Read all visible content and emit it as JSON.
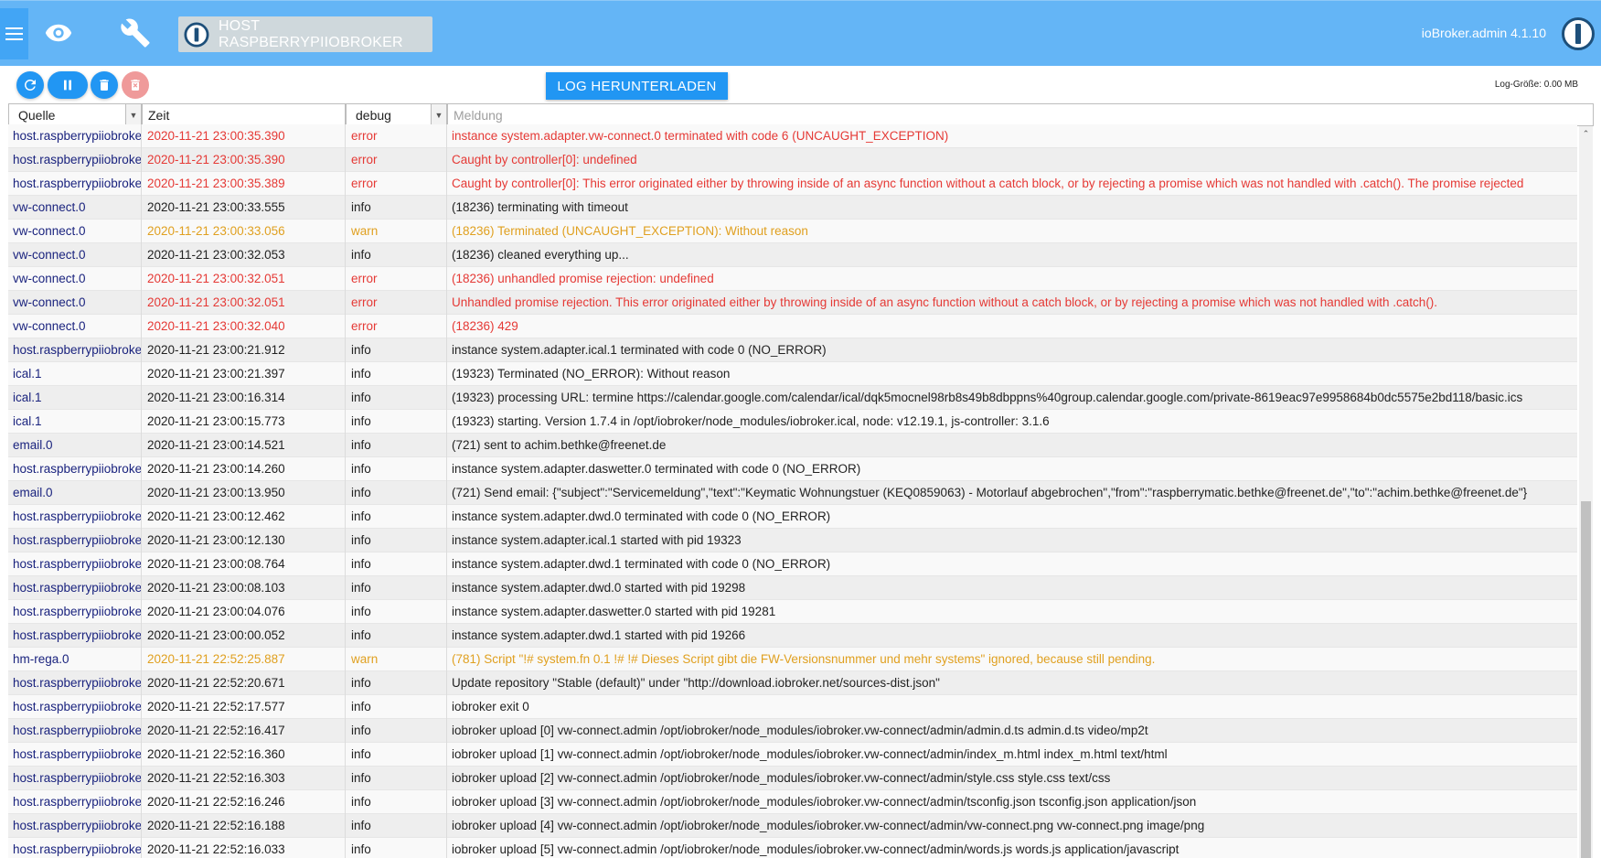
{
  "header": {
    "host_label": "HOST RASPBERRYPIIOBROKER",
    "version": "ioBroker.admin 4.1.10",
    "icons": [
      "menu-icon",
      "eye-icon",
      "wrench-icon",
      "iobroker-logo-icon"
    ]
  },
  "toolbar": {
    "buttons": [
      "refresh-icon",
      "pause-icon",
      "trash-icon",
      "delete-disabled-icon"
    ],
    "download_label": "LOG HERUNTERLADEN",
    "log_size": "Log-Größe: 0.00 MB"
  },
  "filters": {
    "source": "Quelle",
    "time": "Zeit",
    "severity": "debug",
    "message_placeholder": "Meldung"
  },
  "logs": [
    {
      "source": "host.raspberrypiiobroker",
      "time": "2020-11-21 23:00:35.390",
      "severity": "error",
      "message": "instance system.adapter.vw-connect.0 terminated with code 6 (UNCAUGHT_EXCEPTION)"
    },
    {
      "source": "host.raspberrypiiobroker",
      "time": "2020-11-21 23:00:35.390",
      "severity": "error",
      "message": "Caught by controller[0]: undefined"
    },
    {
      "source": "host.raspberrypiiobroker",
      "time": "2020-11-21 23:00:35.389",
      "severity": "error",
      "message": "Caught by controller[0]: This error originated either by throwing inside of an async function without a catch block, or by rejecting a promise which was not handled with .catch(). The promise rejected"
    },
    {
      "source": "vw-connect.0",
      "time": "2020-11-21 23:00:33.555",
      "severity": "info",
      "message": "(18236) terminating with timeout"
    },
    {
      "source": "vw-connect.0",
      "time": "2020-11-21 23:00:33.056",
      "severity": "warn",
      "message": "(18236) Terminated (UNCAUGHT_EXCEPTION): Without reason"
    },
    {
      "source": "vw-connect.0",
      "time": "2020-11-21 23:00:32.053",
      "severity": "info",
      "message": "(18236) cleaned everything up..."
    },
    {
      "source": "vw-connect.0",
      "time": "2020-11-21 23:00:32.051",
      "severity": "error",
      "message": "(18236) unhandled promise rejection: undefined"
    },
    {
      "source": "vw-connect.0",
      "time": "2020-11-21 23:00:32.051",
      "severity": "error",
      "message": "Unhandled promise rejection. This error originated either by throwing inside of an async function without a catch block, or by rejecting a promise which was not handled with .catch()."
    },
    {
      "source": "vw-connect.0",
      "time": "2020-11-21 23:00:32.040",
      "severity": "error",
      "message": "(18236) 429"
    },
    {
      "source": "host.raspberrypiiobroker",
      "time": "2020-11-21 23:00:21.912",
      "severity": "info",
      "message": "instance system.adapter.ical.1 terminated with code 0 (NO_ERROR)"
    },
    {
      "source": "ical.1",
      "time": "2020-11-21 23:00:21.397",
      "severity": "info",
      "message": "(19323) Terminated (NO_ERROR): Without reason"
    },
    {
      "source": "ical.1",
      "time": "2020-11-21 23:00:16.314",
      "severity": "info",
      "message": "(19323) processing URL: termine https://calendar.google.com/calendar/ical/dqk5mocnel98rb8s49b8dbppns%40group.calendar.google.com/private-8619eac97e9958684b0dc5575e2bd118/basic.ics"
    },
    {
      "source": "ical.1",
      "time": "2020-11-21 23:00:15.773",
      "severity": "info",
      "message": "(19323) starting. Version 1.7.4 in /opt/iobroker/node_modules/iobroker.ical, node: v12.19.1, js-controller: 3.1.6"
    },
    {
      "source": "email.0",
      "time": "2020-11-21 23:00:14.521",
      "severity": "info",
      "message": "(721) sent to achim.bethke@freenet.de"
    },
    {
      "source": "host.raspberrypiiobroker",
      "time": "2020-11-21 23:00:14.260",
      "severity": "info",
      "message": "instance system.adapter.daswetter.0 terminated with code 0 (NO_ERROR)"
    },
    {
      "source": "email.0",
      "time": "2020-11-21 23:00:13.950",
      "severity": "info",
      "message": "(721) Send email: {\"subject\":\"Servicemeldung\",\"text\":\"Keymatic Wohnungstuer (KEQ0859063) - Motorlauf abgebrochen\",\"from\":\"raspberrymatic.bethke@freenet.de\",\"to\":\"achim.bethke@freenet.de\"}"
    },
    {
      "source": "host.raspberrypiiobroker",
      "time": "2020-11-21 23:00:12.462",
      "severity": "info",
      "message": "instance system.adapter.dwd.0 terminated with code 0 (NO_ERROR)"
    },
    {
      "source": "host.raspberrypiiobroker",
      "time": "2020-11-21 23:00:12.130",
      "severity": "info",
      "message": "instance system.adapter.ical.1 started with pid 19323"
    },
    {
      "source": "host.raspberrypiiobroker",
      "time": "2020-11-21 23:00:08.764",
      "severity": "info",
      "message": "instance system.adapter.dwd.1 terminated with code 0 (NO_ERROR)"
    },
    {
      "source": "host.raspberrypiiobroker",
      "time": "2020-11-21 23:00:08.103",
      "severity": "info",
      "message": "instance system.adapter.dwd.0 started with pid 19298"
    },
    {
      "source": "host.raspberrypiiobroker",
      "time": "2020-11-21 23:00:04.076",
      "severity": "info",
      "message": "instance system.adapter.daswetter.0 started with pid 19281"
    },
    {
      "source": "host.raspberrypiiobroker",
      "time": "2020-11-21 23:00:00.052",
      "severity": "info",
      "message": "instance system.adapter.dwd.1 started with pid 19266"
    },
    {
      "source": "hm-rega.0",
      "time": "2020-11-21 22:52:25.887",
      "severity": "warn",
      "message": "(781) Script \"!# system.fn 0.1 !# !# Dieses Script gibt die FW-Versionsnummer und mehr systems\" ignored, because still pending."
    },
    {
      "source": "host.raspberrypiiobroker",
      "time": "2020-11-21 22:52:20.671",
      "severity": "info",
      "message": "Update repository \"Stable (default)\" under \"http://download.iobroker.net/sources-dist.json\""
    },
    {
      "source": "host.raspberrypiiobroker",
      "time": "2020-11-21 22:52:17.577",
      "severity": "info",
      "message": "iobroker exit 0"
    },
    {
      "source": "host.raspberrypiiobroker",
      "time": "2020-11-21 22:52:16.417",
      "severity": "info",
      "message": "iobroker upload [0] vw-connect.admin /opt/iobroker/node_modules/iobroker.vw-connect/admin/admin.d.ts admin.d.ts video/mp2t"
    },
    {
      "source": "host.raspberrypiiobroker",
      "time": "2020-11-21 22:52:16.360",
      "severity": "info",
      "message": "iobroker upload [1] vw-connect.admin /opt/iobroker/node_modules/iobroker.vw-connect/admin/index_m.html index_m.html text/html"
    },
    {
      "source": "host.raspberrypiiobroker",
      "time": "2020-11-21 22:52:16.303",
      "severity": "info",
      "message": "iobroker upload [2] vw-connect.admin /opt/iobroker/node_modules/iobroker.vw-connect/admin/style.css style.css text/css"
    },
    {
      "source": "host.raspberrypiiobroker",
      "time": "2020-11-21 22:52:16.246",
      "severity": "info",
      "message": "iobroker upload [3] vw-connect.admin /opt/iobroker/node_modules/iobroker.vw-connect/admin/tsconfig.json tsconfig.json application/json"
    },
    {
      "source": "host.raspberrypiiobroker",
      "time": "2020-11-21 22:52:16.188",
      "severity": "info",
      "message": "iobroker upload [4] vw-connect.admin /opt/iobroker/node_modules/iobroker.vw-connect/admin/vw-connect.png vw-connect.png image/png"
    },
    {
      "source": "host.raspberrypiiobroker",
      "time": "2020-11-21 22:52:16.033",
      "severity": "info",
      "message": "iobroker upload [5] vw-connect.admin /opt/iobroker/node_modules/iobroker.vw-connect/admin/words.js words.js application/javascript"
    }
  ],
  "colors": {
    "header_bg": "#64b5f6",
    "accent": "#2196f3",
    "error": "#e53935",
    "warn": "#e0a020",
    "source_text": "#1a237e"
  }
}
